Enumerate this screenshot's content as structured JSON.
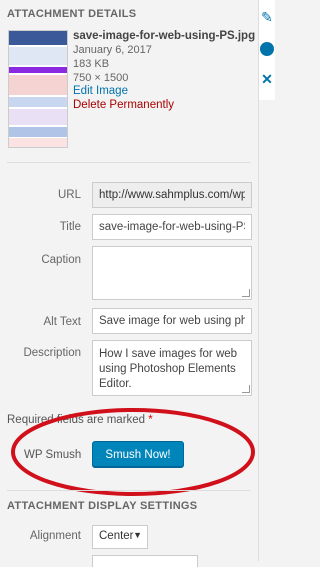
{
  "attachment_details": {
    "heading": "ATTACHMENT DETAILS",
    "filename": "save-image-for-web-using-PS.jpg",
    "date": "January 6, 2017",
    "size": "183 KB",
    "dimensions": "750 × 1500",
    "edit_link": "Edit Image",
    "delete_link": "Delete Permanently"
  },
  "fields": {
    "url_label": "URL",
    "url_value": "http://www.sahmplus.com/wp",
    "title_label": "Title",
    "title_value": "save-image-for-web-using-PS",
    "caption_label": "Caption",
    "caption_value": "",
    "alt_label": "Alt Text",
    "alt_value": "Save image for web using pho",
    "description_label": "Description",
    "description_value": "How I save images for web using Photoshop Elements Editor."
  },
  "required_note": {
    "text": "Required fields are marked",
    "star": "*"
  },
  "smush": {
    "label": "WP Smush",
    "button_label": "Smush Now!"
  },
  "display_settings": {
    "heading": "ATTACHMENT DISPLAY SETTINGS",
    "alignment_label": "Alignment",
    "alignment_value": "Center"
  },
  "colors": {
    "link": "#0073aa",
    "delete": "#aa0000",
    "button": "#0085ba",
    "annotation": "#d0101a"
  },
  "icons": {
    "rail": [
      "pencil-icon",
      "circle-icon",
      "close-icon"
    ],
    "select": "chevron-down-icon"
  }
}
